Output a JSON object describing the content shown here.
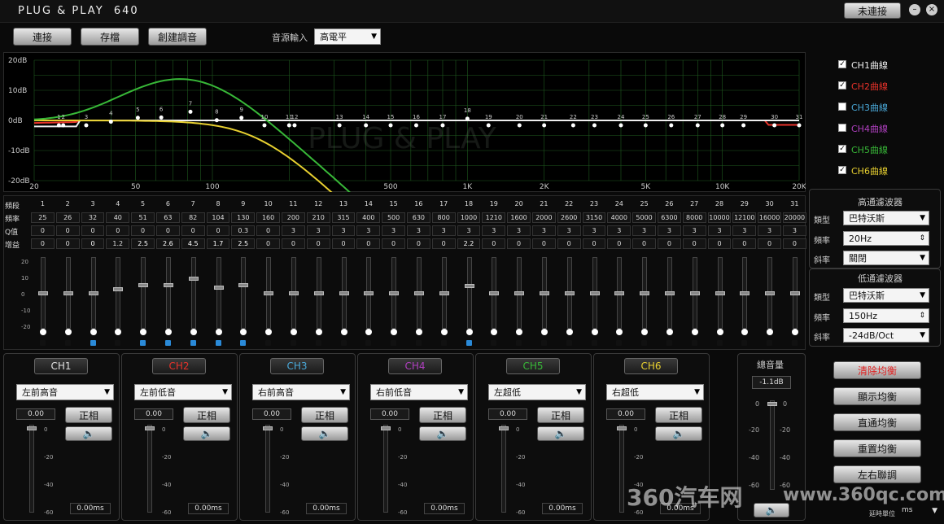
{
  "title": "PLUG & PLAY  640",
  "status_button": "未連接",
  "toolbar": {
    "buttons": [
      "連接",
      "存檔",
      "創建調音"
    ],
    "input_label": "音源輸入",
    "input_value": "高電平"
  },
  "eq_graph": {
    "y_labels": [
      "20dB",
      "10dB",
      "0dB",
      "-10dB",
      "-20dB"
    ],
    "x_labels": [
      "20",
      "50",
      "100",
      "500",
      "1K",
      "2K",
      "5K",
      "10K",
      "20K"
    ],
    "watermark": "PLUG & PLAY"
  },
  "channel_toggles": [
    {
      "label": "CH1曲線",
      "checked": true,
      "color": "#eeeeee"
    },
    {
      "label": "CH2曲線",
      "checked": true,
      "color": "#e8322a"
    },
    {
      "label": "CH3曲線",
      "checked": false,
      "color": "#4aa8d8"
    },
    {
      "label": "CH4曲線",
      "checked": false,
      "color": "#b040c0"
    },
    {
      "label": "CH5曲線",
      "checked": true,
      "color": "#38b838"
    },
    {
      "label": "CH6曲線",
      "checked": true,
      "color": "#e8d030"
    }
  ],
  "eq_table": {
    "row_labels": [
      "頻段",
      "頻率",
      "Q值",
      "增益"
    ],
    "bands": [
      "1",
      "2",
      "3",
      "4",
      "5",
      "6",
      "7",
      "8",
      "9",
      "10",
      "11",
      "12",
      "13",
      "14",
      "15",
      "16",
      "17",
      "18",
      "19",
      "20",
      "21",
      "22",
      "23",
      "24",
      "25",
      "26",
      "27",
      "28",
      "29",
      "30",
      "31"
    ],
    "freqs": [
      "25",
      "26",
      "32",
      "40",
      "51",
      "63",
      "82",
      "104",
      "130",
      "160",
      "200",
      "210",
      "315",
      "400",
      "500",
      "630",
      "800",
      "1000",
      "1210",
      "1600",
      "2000",
      "2600",
      "3150",
      "4000",
      "5000",
      "6300",
      "8000",
      "10000",
      "12100",
      "16000",
      "20000"
    ],
    "q": [
      "0",
      "0",
      "0",
      "0",
      "0",
      "0",
      "0",
      "0",
      "0.3",
      "0",
      "3",
      "3",
      "3",
      "3",
      "3",
      "3",
      "3",
      "3",
      "3",
      "3",
      "3",
      "3",
      "3",
      "3",
      "3",
      "3",
      "3",
      "3",
      "3",
      "3",
      "3"
    ],
    "gain": [
      "0",
      "0",
      "0",
      "1.2",
      "2.5",
      "2.6",
      "4.5",
      "1.7",
      "2.5",
      "0",
      "0",
      "0",
      "0",
      "0",
      "0",
      "0",
      "0",
      "2.2",
      "0",
      "0",
      "0",
      "0",
      "0",
      "0",
      "0",
      "0",
      "0",
      "0",
      "0",
      "0",
      "0"
    ],
    "active": [
      false,
      false,
      true,
      false,
      true,
      true,
      true,
      true,
      true,
      false,
      false,
      false,
      false,
      false,
      false,
      false,
      false,
      true,
      false,
      false,
      false,
      false,
      false,
      false,
      false,
      false,
      false,
      false,
      false,
      false,
      false
    ]
  },
  "fader_scale": [
    "20",
    "10",
    "0",
    "-10",
    "-20"
  ],
  "highpass": {
    "title": "高通濾波器",
    "type_label": "類型",
    "type_value": "巴特沃斯",
    "freq_label": "頻率",
    "freq_value": "20Hz",
    "slope_label": "斜率",
    "slope_value": "關閉"
  },
  "lowpass": {
    "title": "低通濾波器",
    "type_label": "類型",
    "type_value": "巴特沃斯",
    "freq_label": "頻率",
    "freq_value": "150Hz",
    "slope_label": "斜率",
    "slope_value": "-24dB/Oct"
  },
  "channels": [
    {
      "name": "CH1",
      "color": "#e0e0e0",
      "output": "左前高音",
      "gain": "0.00",
      "phase": "正相",
      "delay": "0.00ms",
      "marks": [
        "0",
        "-20",
        "-40",
        "-60"
      ]
    },
    {
      "name": "CH2",
      "color": "#e8322a",
      "output": "左前低音",
      "gain": "0.00",
      "phase": "正相",
      "delay": "0.00ms",
      "marks": [
        "0",
        "-20",
        "-40",
        "-60"
      ]
    },
    {
      "name": "CH3",
      "color": "#4aa8d8",
      "output": "右前高音",
      "gain": "0.00",
      "phase": "正相",
      "delay": "0.00ms",
      "marks": [
        "0",
        "-20",
        "-40",
        "-60"
      ]
    },
    {
      "name": "CH4",
      "color": "#b040c0",
      "output": "右前低音",
      "gain": "0.00",
      "phase": "正相",
      "delay": "0.00ms",
      "marks": [
        "0",
        "-20",
        "-40",
        "-60"
      ]
    },
    {
      "name": "CH5",
      "color": "#38b838",
      "output": "左超低",
      "gain": "0.00",
      "phase": "正相",
      "delay": "0.00ms",
      "marks": [
        "0",
        "-20",
        "-40",
        "-60"
      ]
    },
    {
      "name": "CH6",
      "color": "#e8d030",
      "output": "右超低",
      "gain": "0.00",
      "phase": "正相",
      "delay": "0.00ms",
      "marks": [
        "0",
        "-20",
        "-40",
        "-60"
      ]
    }
  ],
  "master": {
    "title": "總音量",
    "value": "-1.1dB",
    "marks": [
      "0",
      "-20",
      "-40",
      "-60"
    ]
  },
  "right_buttons": [
    "清除均衡",
    "顯示均衡",
    "直通均衡",
    "重置均衡",
    "左右聯調"
  ],
  "delay_unit": {
    "label": "延時單位",
    "value": "ms"
  },
  "watermark": {
    "brand": "360汽车网",
    "url": "www.360qc.com"
  }
}
